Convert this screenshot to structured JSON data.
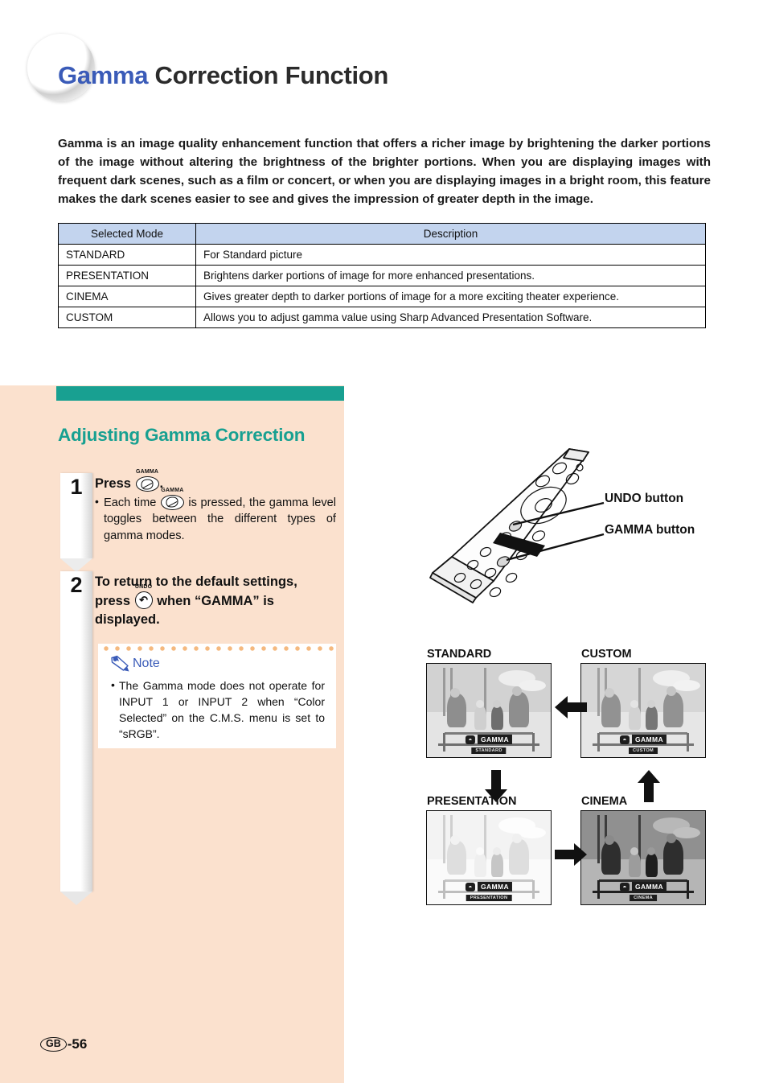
{
  "header": {
    "title_accent": "Gamma",
    "title_rest": " Correction Function",
    "accent_color": "#3a5bb8"
  },
  "intro": "Gamma is an image quality enhancement function that offers a richer image by brightening the darker portions of the image without altering the brightness of the brighter portions. When you are displaying images with frequent dark scenes, such as a film or concert, or when you are displaying images in a bright room, this feature makes the dark scenes easier to see and gives the impression of greater depth in the image.",
  "mode_table": {
    "headers": [
      "Selected Mode",
      "Description"
    ],
    "header_bg": "#c3d4ee",
    "rows": [
      {
        "mode": "STANDARD",
        "description": "For Standard picture"
      },
      {
        "mode": "PRESENTATION",
        "description": "Brightens darker portions of image for more enhanced presentations."
      },
      {
        "mode": "CINEMA",
        "description": "Gives greater depth to darker portions of image for a more exciting theater experience."
      },
      {
        "mode": "CUSTOM",
        "description": "Allows you to adjust gamma value using Sharp Advanced Presentation Software."
      }
    ]
  },
  "section": {
    "title": "Adjusting Gamma Correction",
    "bar_color": "#18a091",
    "title_color": "#18a091",
    "panel_bg": "#fbe1ce"
  },
  "steps": [
    {
      "number": "1",
      "head_before": "Press ",
      "key_caption": "GAMMA",
      "head_after": ".",
      "bullet_before": "Each time ",
      "bullet_key_caption": "GAMMA",
      "bullet_after": " is pressed, the gamma level toggles between the different types of gamma modes."
    },
    {
      "number": "2",
      "head_before": "To return to the default settings, press ",
      "key_caption": "UNDO",
      "head_after": " when “GAMMA” is displayed."
    }
  ],
  "note": {
    "label": "Note",
    "label_color": "#3a5bb8",
    "items": [
      "The Gamma mode does not operate for INPUT 1 or INPUT 2 when “Color Selected” on the C.M.S. menu is set to “sRGB”."
    ]
  },
  "figure": {
    "callouts": [
      {
        "label": "UNDO button"
      },
      {
        "label": "GAMMA button"
      }
    ]
  },
  "samples": [
    {
      "caption": "STANDARD",
      "osd_label": "GAMMA",
      "osd_mode": "STANDARD"
    },
    {
      "caption": "CUSTOM",
      "osd_label": "GAMMA",
      "osd_mode": "CUSTOM"
    },
    {
      "caption": "PRESENTATION",
      "osd_label": "GAMMA",
      "osd_mode": "PRESENTATION"
    },
    {
      "caption": "CINEMA",
      "osd_label": "GAMMA",
      "osd_mode": "CINEMA"
    }
  ],
  "flow_arrows": {
    "custom_to_standard": "←",
    "presentation_to_cinema": "→",
    "standard_to_presentation": "↓",
    "cinema_to_custom": "↑"
  },
  "footer": {
    "region_code": "GB",
    "page_number": "-56"
  }
}
